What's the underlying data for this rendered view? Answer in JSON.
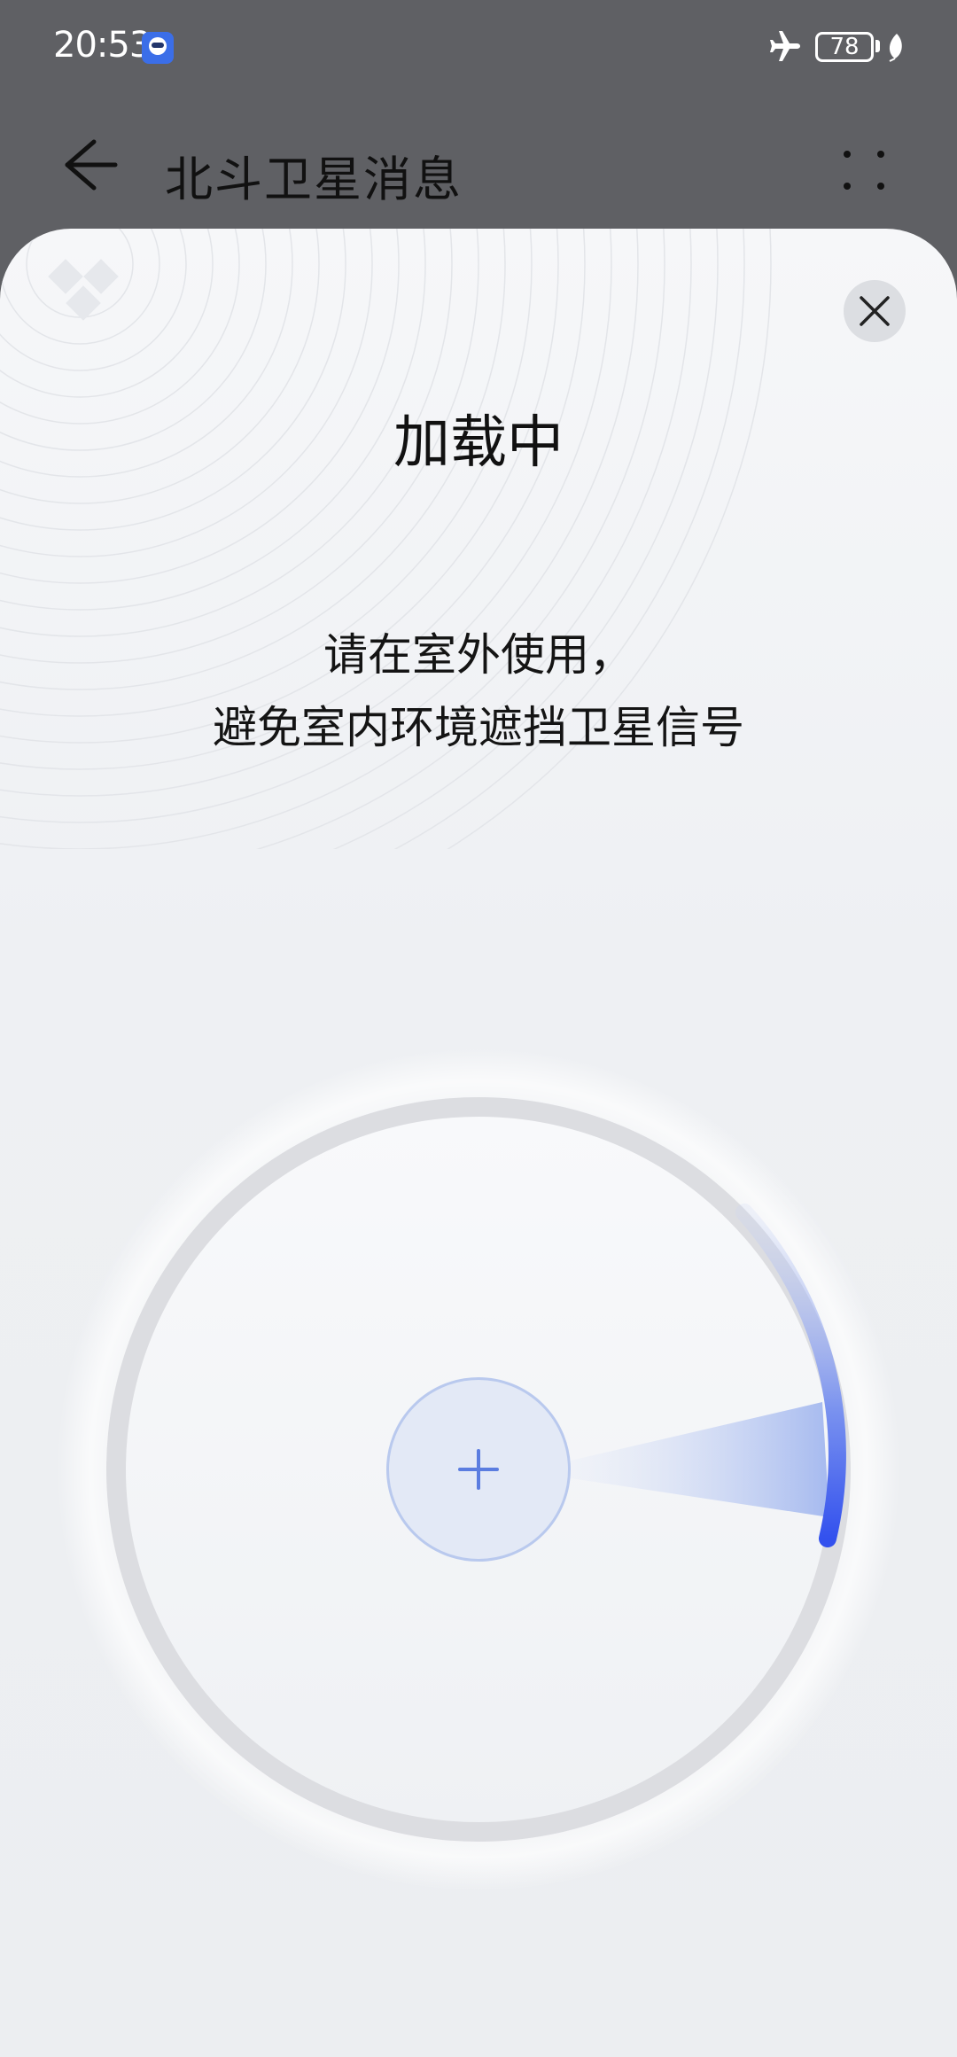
{
  "status_bar": {
    "time": "20:53",
    "battery_level": "78",
    "icons": [
      "app-notification-icon",
      "airplane-icon",
      "battery-icon",
      "leaf-icon"
    ]
  },
  "header": {
    "title": "北斗卫星消息",
    "back_icon": "arrow-left-icon",
    "more_icon": "more-dots-icon"
  },
  "sheet": {
    "title": "加载中",
    "hint_lines": [
      "请在室外使用，",
      "避免室内环境遮挡卫星信号"
    ],
    "close_icon": "close-icon",
    "center_icon": "plus-icon"
  },
  "colors": {
    "status_bar_bg": "#5f6064",
    "sheet_bg": "#eef0f3",
    "accent_blue": "#3a5bf0",
    "text_dark": "#111111"
  }
}
